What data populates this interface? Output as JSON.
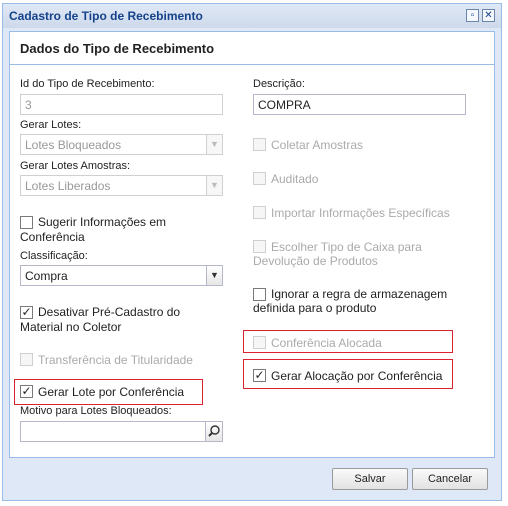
{
  "window": {
    "title": "Cadastro de Tipo de Recebimento"
  },
  "panel": {
    "title": "Dados do Tipo de Recebimento"
  },
  "left": {
    "id_label": "Id do Tipo de Recebimento:",
    "id_value": "3",
    "gerar_lotes_label": "Gerar Lotes:",
    "gerar_lotes_value": "Lotes Bloqueados",
    "gerar_lotes_amostras_label": "Gerar Lotes Amostras:",
    "gerar_lotes_amostras_value": "Lotes Liberados",
    "sugerir_line1": "Sugerir Informações em",
    "sugerir_line2": "Conferência",
    "classificacao_label": "Classificação:",
    "classificacao_value": "Compra",
    "desativar_line1": "Desativar Pré-Cadastro do",
    "desativar_line2": "Material no Coletor",
    "transferencia": "Transferência de Titularidade",
    "gerar_lote_conferencia": "Gerar Lote por Conferência",
    "motivo_label": "Motivo para Lotes Bloqueados:",
    "motivo_value": ""
  },
  "right": {
    "descricao_label": "Descrição:",
    "descricao_value": "COMPRA",
    "coletar_amostras": "Coletar Amostras",
    "auditado": "Auditado",
    "importar": "Importar Informações Específicas",
    "escolher_line1": "Escolher Tipo de Caixa para",
    "escolher_line2": "Devolução de Produtos",
    "ignorar_line1": "Ignorar a regra de armazenagem",
    "ignorar_line2": "definida para o produto",
    "conferencia_alocada": "Conferência Alocada",
    "gerar_alocacao": "Gerar Alocação por Conferência"
  },
  "checkbox_states": {
    "sugerir": false,
    "desativar": true,
    "transferencia": false,
    "gerar_lote_conferencia": true,
    "coletar_amostras": false,
    "auditado": false,
    "importar": false,
    "escolher": false,
    "ignorar": false,
    "conferencia_alocada": false,
    "gerar_alocacao": true
  },
  "buttons": {
    "save": "Salvar",
    "cancel": "Cancelar"
  },
  "colors": {
    "highlight": "#d9232e",
    "border": "#99bbe8"
  },
  "icons": {
    "maximize": "maximize-icon",
    "close": "close-icon",
    "search": "search-icon",
    "dropdown": "chevron-down-icon"
  }
}
